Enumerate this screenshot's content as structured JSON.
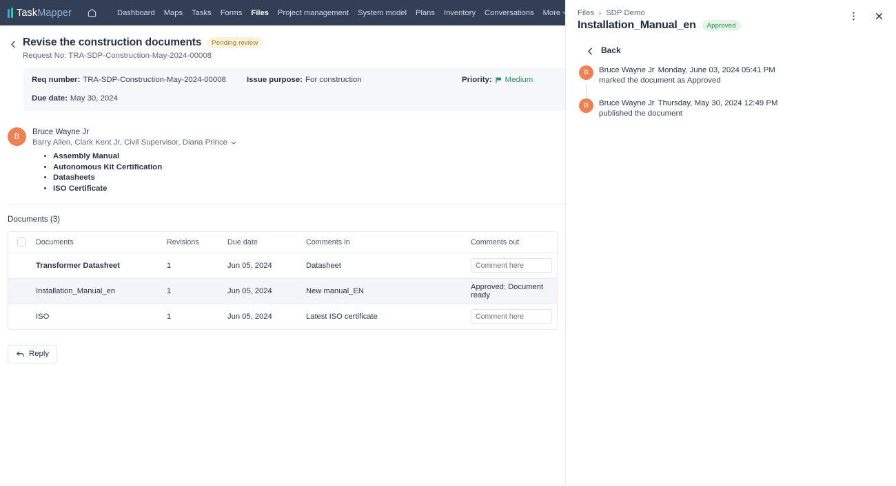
{
  "topnav": {
    "logo": {
      "part1": "Task",
      "part2": "Mapper"
    },
    "home_icon": "home-icon",
    "items": [
      {
        "label": "Dashboard",
        "active": false
      },
      {
        "label": "Maps",
        "active": false
      },
      {
        "label": "Tasks",
        "active": false
      },
      {
        "label": "Forms",
        "active": false
      },
      {
        "label": "Files",
        "active": true
      },
      {
        "label": "Project management",
        "active": false
      },
      {
        "label": "System model",
        "active": false
      },
      {
        "label": "Plans",
        "active": false
      },
      {
        "label": "Inventory",
        "active": false
      },
      {
        "label": "Conversations",
        "active": false
      },
      {
        "label": "More",
        "active": false
      }
    ]
  },
  "page": {
    "title": "Revise the construction documents",
    "status_badge": "Pending review",
    "request_no": "Request No: TRA-SDP-Construction-May-2024-00008",
    "back_icon": "chevron-left-icon"
  },
  "info_card": {
    "req_number_label": "Req number:",
    "req_number_value": "TRA-SDP-Construction-May-2024-00008",
    "issue_purpose_label": "Issue purpose:",
    "issue_purpose_value": "For construction",
    "priority_label": "Priority:",
    "priority_value": "Medium",
    "priority_color": "#2e9159",
    "due_date_label": "Due date:",
    "due_date_value": "May 30, 2024"
  },
  "comment": {
    "avatar_initial": "B",
    "author": "Bruce Wayne Jr",
    "recipients": "Barry Allen, Clark Kent Jr, Civil Supervisor, Diana Prince",
    "expand_icon": "chevron-down-icon",
    "bullets": [
      "Assembly Manual",
      "Autonomous Kit Certification",
      "Datasheets",
      "ISO Certificate"
    ]
  },
  "documents": {
    "heading": "Documents (3)",
    "columns": [
      "Documents",
      "Revisions",
      "Due date",
      "Comments in",
      "Comments out"
    ],
    "rows": [
      {
        "document": "Transformer Datasheet",
        "revisions": "1",
        "due_date": "Jun 05, 2024",
        "comments_in": "Datasheet",
        "comments_out": "",
        "comments_out_placeholder": "Comment here",
        "comments_out_is_input": true,
        "highlighted": false
      },
      {
        "document": "Installation_Manual_en",
        "revisions": "1",
        "due_date": "Jun 05, 2024",
        "comments_in": "New manual_EN",
        "comments_out": "Approved: Document ready",
        "comments_out_placeholder": "",
        "comments_out_is_input": false,
        "highlighted": true
      },
      {
        "document": "ISO",
        "revisions": "1",
        "due_date": "Jun 05, 2024",
        "comments_in": "Latest ISO certificate",
        "comments_out": "",
        "comments_out_placeholder": "Comment here",
        "comments_out_is_input": true,
        "highlighted": false
      }
    ]
  },
  "reply": {
    "label": "Reply",
    "icon": "reply-arrow-icon"
  },
  "side_panel": {
    "breadcrumb": [
      "Files",
      "SDP Demo"
    ],
    "breadcrumb_sep_icon": "chevron-right-icon",
    "title": "Installation_Manual_en",
    "status_badge": "Approved",
    "more_icon": "more-vertical-icon",
    "close_icon": "close-icon",
    "back_label": "Back",
    "back_icon": "chevron-left-icon",
    "timeline": [
      {
        "avatar_initial": "B",
        "author": "Bruce Wayne Jr",
        "timestamp": "Monday, June 03, 2024 05:41 PM",
        "action": "marked the document as Approved"
      },
      {
        "avatar_initial": "B",
        "author": "Bruce Wayne Jr",
        "timestamp": "Thursday, May 30, 2024 12:49 PM",
        "action": "published the document"
      }
    ]
  }
}
